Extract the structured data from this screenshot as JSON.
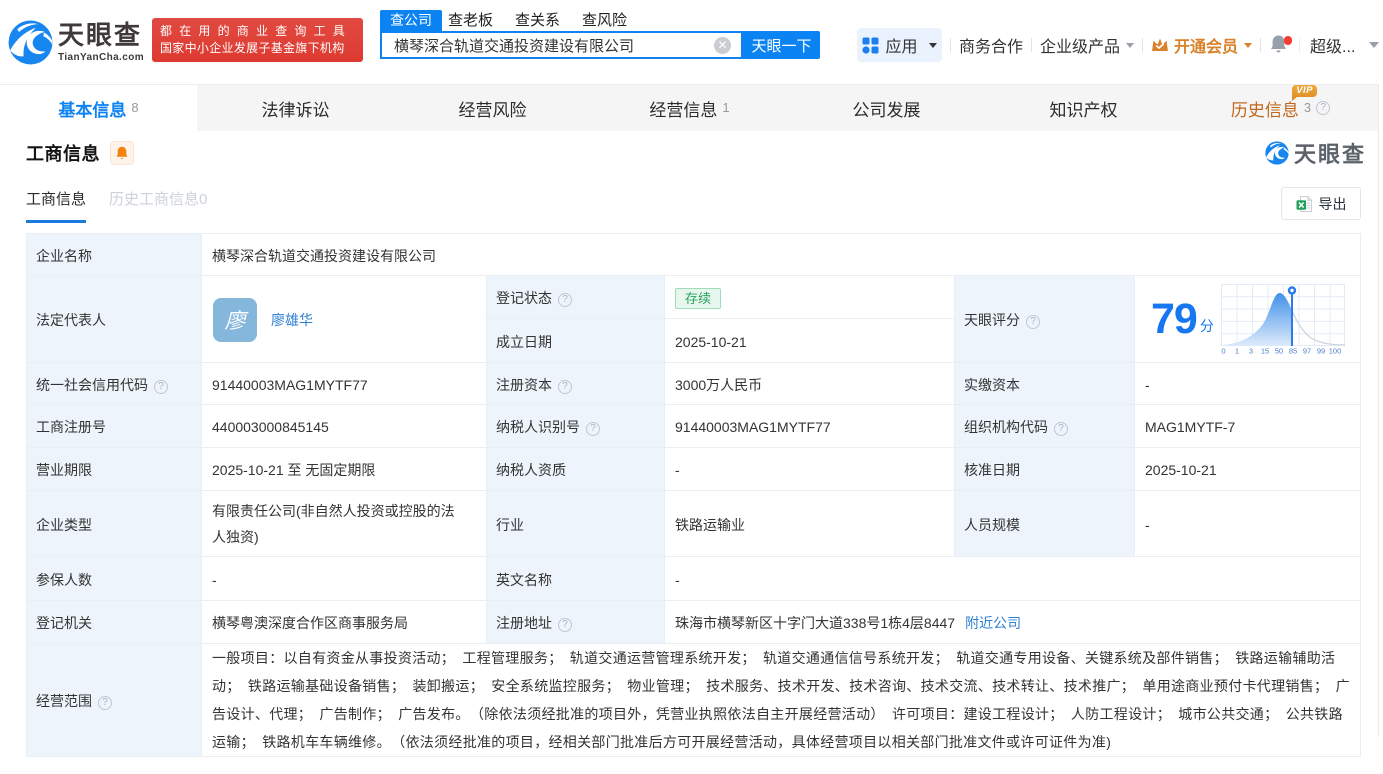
{
  "brand": {
    "title": "天眼查",
    "domain": "TianYanCha.com",
    "slogan_line1": "都在用的商业查询工具",
    "slogan_line2": "国家中小企业发展子基金旗下机构"
  },
  "search": {
    "tabs": [
      "查公司",
      "查老板",
      "查关系",
      "查风险"
    ],
    "active_tab": "查公司",
    "value": "横琴深合轨道交通投资建设有限公司",
    "button_label": "天眼一下"
  },
  "header_menu": {
    "apps": "应用",
    "business_cooperation": "商务合作",
    "enterprise_products": "企业级产品",
    "open_vip": "开通会员",
    "super": "超级..."
  },
  "nav_tabs": [
    {
      "label": "基本信息",
      "count": "8"
    },
    {
      "label": "法律诉讼",
      "count": ""
    },
    {
      "label": "经营风险",
      "count": ""
    },
    {
      "label": "经营信息",
      "count": "1"
    },
    {
      "label": "公司发展",
      "count": ""
    },
    {
      "label": "知识产权",
      "count": ""
    },
    {
      "label": "历史信息",
      "count": "3",
      "vip": "VIP"
    }
  ],
  "section": {
    "title": "工商信息",
    "watermark": "天眼查",
    "subtab_active": "工商信息",
    "subtab_inactive": "历史工商信息0",
    "export_label": "导出"
  },
  "table": {
    "company_name": {
      "label": "企业名称",
      "value": "横琴深合轨道交通投资建设有限公司"
    },
    "legal_rep": {
      "label": "法定代表人",
      "avatar_char": "廖",
      "name": "廖雄华"
    },
    "reg_status": {
      "label": "登记状态",
      "value": "存续"
    },
    "establish_date": {
      "label": "成立日期",
      "value": "2025-10-21"
    },
    "score": {
      "label": "天眼评分",
      "value": "79",
      "unit": "分",
      "axis_labels": [
        "0",
        "1",
        "3",
        "15",
        "50",
        "85",
        "97",
        "99",
        "100"
      ]
    },
    "credit_code": {
      "label": "统一社会信用代码",
      "value": "91440003MAG1MYTF77"
    },
    "reg_capital": {
      "label": "注册资本",
      "value": "3000万人民币"
    },
    "paid_capital": {
      "label": "实缴资本",
      "value": "-"
    },
    "reg_number": {
      "label": "工商注册号",
      "value": "440003000845145"
    },
    "taxpayer_id": {
      "label": "纳税人识别号",
      "value": "91440003MAG1MYTF77"
    },
    "org_code": {
      "label": "组织机构代码",
      "value": "MAG1MYTF-7"
    },
    "business_term": {
      "label": "营业期限",
      "value": "2025-10-21 至 无固定期限"
    },
    "taxpayer_quality": {
      "label": "纳税人资质",
      "value": "-"
    },
    "approval_date": {
      "label": "核准日期",
      "value": "2025-10-21"
    },
    "company_type": {
      "label": "企业类型",
      "value": "有限责任公司(非自然人投资或控股的法人独资)"
    },
    "industry": {
      "label": "行业",
      "value": "铁路运输业"
    },
    "staff_size": {
      "label": "人员规模",
      "value": "-"
    },
    "insured_count": {
      "label": "参保人数",
      "value": "-"
    },
    "english_name": {
      "label": "英文名称",
      "value": "-"
    },
    "reg_authority": {
      "label": "登记机关",
      "value": "横琴粤澳深度合作区商事服务局"
    },
    "address": {
      "label": "注册地址",
      "value": "珠海市横琴新区十字门大道338号1栋4层8447",
      "link": "附近公司"
    },
    "business_scope": {
      "label": "经营范围",
      "value": "一般项目：以自有资金从事投资活动；　工程管理服务；　轨道交通运营管理系统开发；　轨道交通通信信号系统开发；　轨道交通专用设备、关键系统及部件销售；　铁路运输辅助活动；　铁路运输基础设备销售；　装卸搬运；　安全系统监控服务；　物业管理；　技术服务、技术开发、技术咨询、技术交流、技术转让、技术推广；　单用途商业预付卡代理销售；　广告设计、代理；　广告制作；　广告发布。　（除依法须经批准的项目外，凭营业执照依法自主开展经营活动）　许可项目：建设工程设计；　人防工程设计；　城市公共交通；　公共铁路运输；　铁路机车车辆维修。　（依法须经批准的项目，经相关部门批准后方可开展经营活动，具体经营项目以相关部门批准文件或许可证件为准)"
    }
  },
  "chart_data": {
    "type": "area",
    "title": "天眼评分分布曲线",
    "score": 79,
    "x_tick_labels": [
      "0",
      "1",
      "3",
      "15",
      "50",
      "85",
      "97",
      "99",
      "100"
    ],
    "marker_score": 79,
    "curve_shape": "right-skewed bell, peak near tick 50, marker pin at score 79"
  },
  "colors": {
    "brand_blue": "#0b83f2",
    "link_blue": "#2d7fd4",
    "score_blue": "#1677f0",
    "badge_red": "#dd3a31",
    "history_orange": "#c2661c",
    "vip_orange": "#d9822b",
    "green_tag": "#28a35f",
    "label_bg": "#eef4fb"
  }
}
